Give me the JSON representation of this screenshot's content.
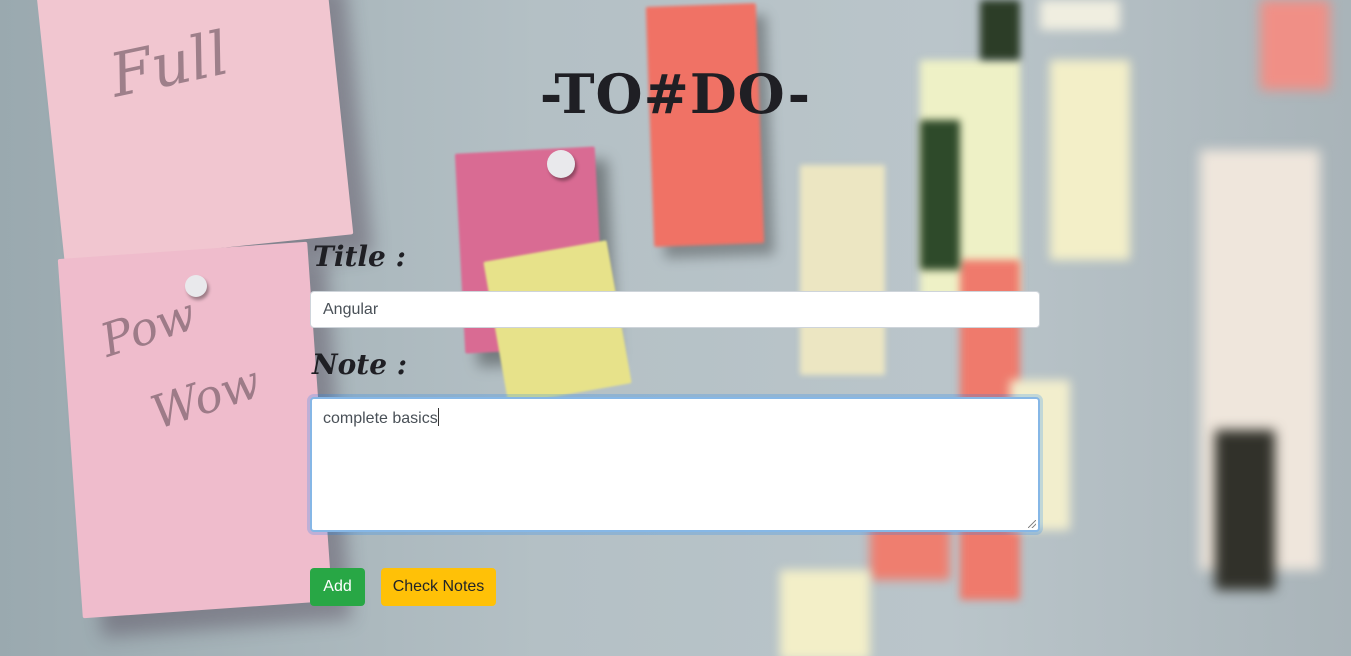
{
  "app": {
    "heading": "-TO#DO-"
  },
  "form": {
    "title_label": "Title :",
    "title_value": "Angular",
    "note_label": "Note :",
    "note_value": "complete basics"
  },
  "buttons": {
    "add_label": "Add",
    "check_notes_label": "Check Notes"
  },
  "background": {
    "scrawl_1": "Full",
    "scrawl_2": "Pow",
    "scrawl_3": "Wow"
  },
  "colors": {
    "add_button": "#28a745",
    "check_notes_button": "#ffc107",
    "focus_border": "#86b7e6"
  }
}
